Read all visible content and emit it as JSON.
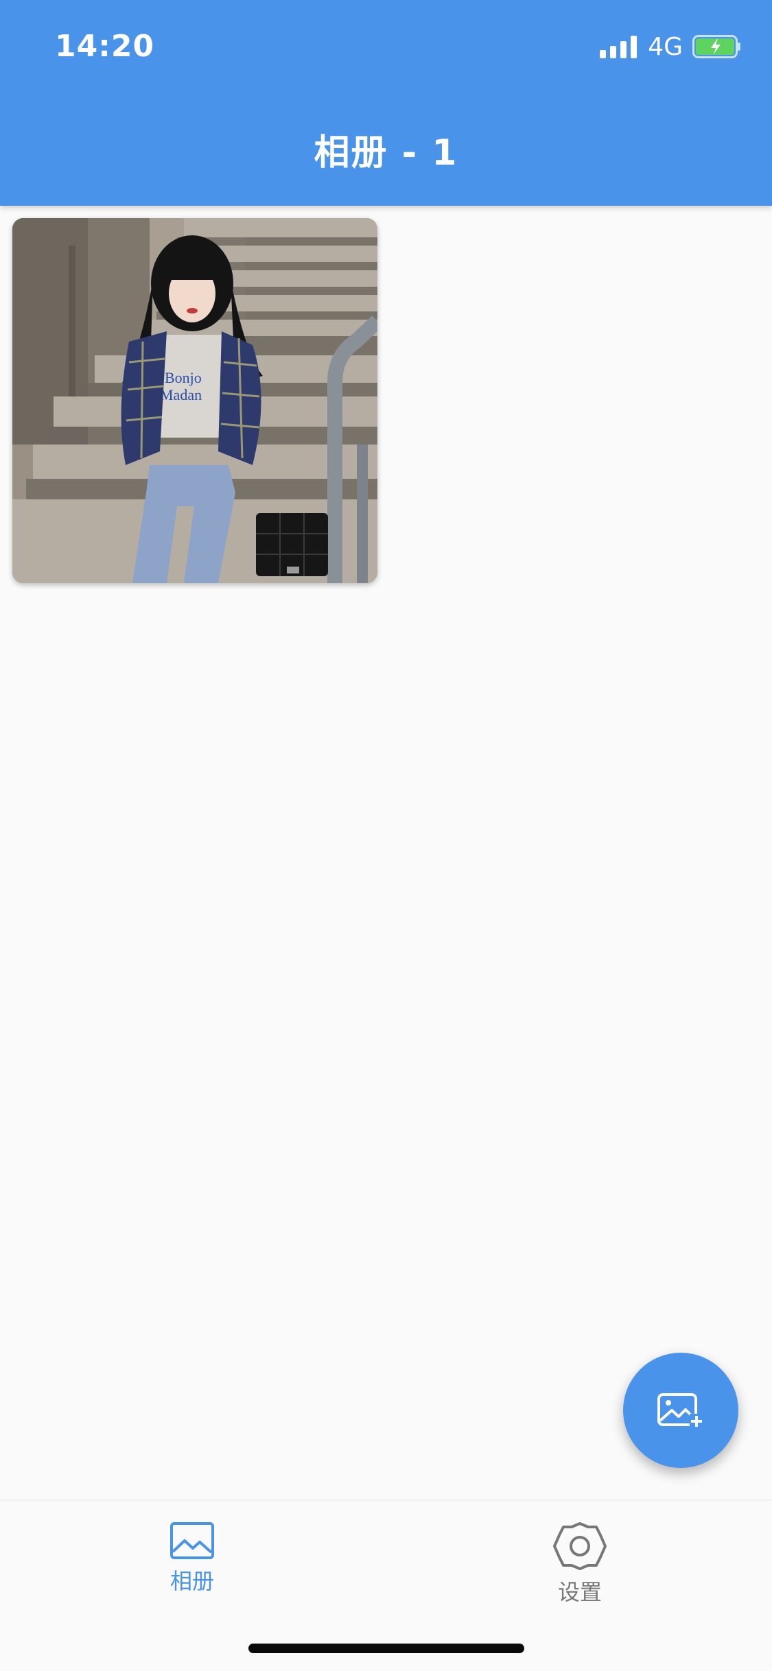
{
  "status_bar": {
    "time": "14:20",
    "network": "4G",
    "signal_bars": 4,
    "battery_state": "charging"
  },
  "header": {
    "title": "相册 - 1"
  },
  "gallery": {
    "photos": [
      {
        "description_icon": "photo-thumbnail"
      }
    ]
  },
  "fab": {
    "icon": "add-photo-icon"
  },
  "bottom_nav": {
    "items": [
      {
        "label": "相册",
        "icon": "image-icon",
        "active": true
      },
      {
        "label": "设置",
        "icon": "gear-icon",
        "active": false
      }
    ]
  },
  "colors": {
    "primary": "#4a93ea",
    "background": "#fafafa",
    "inactive": "#777777",
    "battery_fill": "#5fd35f"
  }
}
